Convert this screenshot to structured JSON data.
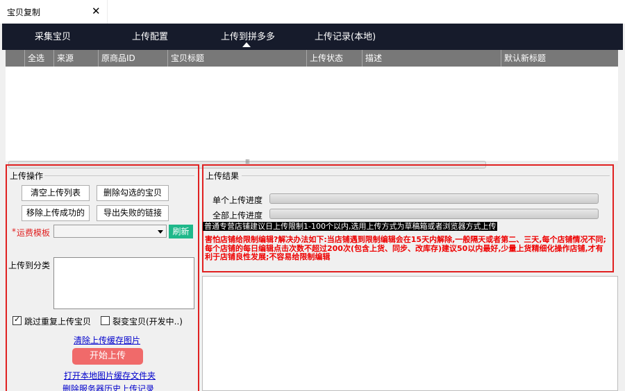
{
  "tab": {
    "label": "宝贝复制",
    "close_glyph": "✕"
  },
  "nav": {
    "items": [
      {
        "label": "采集宝贝",
        "active": false
      },
      {
        "label": "上传配置",
        "active": false
      },
      {
        "label": "上传到拼多多",
        "active": true
      },
      {
        "label": "上传记录(本地)",
        "active": false
      }
    ],
    "bg_color": "#161b2b"
  },
  "grid": {
    "columns": [
      "全选",
      "来源",
      "原商品ID",
      "宝贝标题",
      "上传状态",
      "描述",
      "默认新标题"
    ],
    "rows": [],
    "scroll_grip": "⁞⁞⁞"
  },
  "upload_ops": {
    "title": "上传操作",
    "buttons": {
      "clear_list": "清空上传列表",
      "delete_checked": "删除勾选的宝贝",
      "remove_success": "移除上传成功的",
      "export_failed": "导出失败的链接"
    },
    "freight_required_mark": "*",
    "freight_label": "运费模板",
    "freight_value": "",
    "refresh_label": "刷新",
    "category_label": "上传到分类",
    "category_value": "",
    "skip_duplicate": {
      "label": "跳过重复上传宝贝",
      "checked": true
    },
    "fission": {
      "label": "裂变宝贝(开发中..)",
      "checked": false
    },
    "link_clear_cache": "清除上传缓存图片",
    "start_label": "开始上传",
    "link_open_folder": "打开本地图片缓存文件夹",
    "link_delete_server": "删除服务器历史上传记录"
  },
  "upload_result": {
    "title": "上传结果",
    "single_label": "单个上传进度",
    "all_label": "全部上传进度",
    "single_progress": 0,
    "all_progress": 0,
    "notice_black": "普通专营店铺建议日上传限制1-100个以内,选用上传方式为草稿箱或者浏览器方式上传",
    "notice_red": "害怕店铺给限制编辑?解决办法如下:当店铺遇到限制编辑会在15天内解除,一般隔天或者第二、三天,每个店铺情况不同;每个店铺的每日编辑点击次数不超过200次(包含上货、同步、改库存)建议50以内最好,少量上货精细化操作店铺,才有利于店铺良性发展;不容易给限制编辑"
  },
  "colors": {
    "highlight_border": "#e02020",
    "refresh": "#1fb88a",
    "start": "#f06a6a",
    "link": "#0000cc",
    "notice_red": "#ee0000"
  }
}
